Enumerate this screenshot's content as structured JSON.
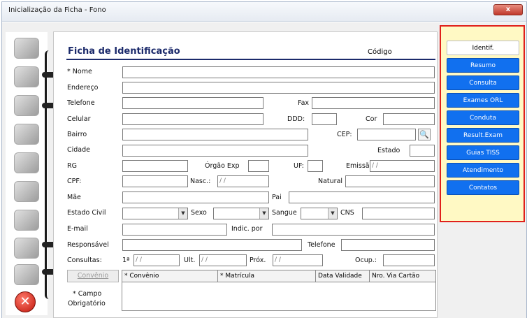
{
  "window": {
    "title": "Inicialização da Ficha - Fono",
    "close_glyph": "x"
  },
  "form": {
    "heading": "Ficha de Identificação",
    "codigo_label": "Código",
    "labels": {
      "nome": "* Nome",
      "endereco": "Endereço",
      "telefone": "Telefone",
      "fax": "Fax",
      "celular": "Celular",
      "ddd": "DDD:",
      "cor": "Cor",
      "bairro": "Bairro",
      "cep": "CEP:",
      "cidade": "Cidade",
      "estado": "Estado",
      "rg": "RG",
      "orgao": "Órgão Exp",
      "uf": "UF:",
      "emissao": "Emissão",
      "cpf": "CPF:",
      "nasc": "Nasc.:",
      "natural": "Natural",
      "mae": "Mãe",
      "pai": "Pai",
      "estado_civil": "Estado Civil",
      "sexo": "Sexo",
      "sangue": "Sangue",
      "cns": "CNS",
      "email": "E-mail",
      "indic_por": "Indic. por",
      "responsavel": "Responsável",
      "telefone2": "Telefone",
      "consultas": "Consultas:",
      "primeira": "1ª",
      "ult": "Ult.",
      "prox": "Próx.",
      "ocup": "Ocup.:"
    },
    "placeholders": {
      "date": " / /"
    },
    "convenio_button": "Convênio",
    "grid_headers": [
      "* Convênio",
      "* Matrícula",
      "Data Validade",
      "Nro. Via Cartão"
    ],
    "required_note_line1": "* Campo",
    "required_note_line2": "Obrigatório"
  },
  "side_tabs": [
    {
      "label": "Identif.",
      "active": true
    },
    {
      "label": "Resumo",
      "active": false
    },
    {
      "label": "Consulta",
      "active": false
    },
    {
      "label": "Exames ORL",
      "active": false
    },
    {
      "label": "Conduta",
      "active": false
    },
    {
      "label": "Result.Exam",
      "active": false
    },
    {
      "label": "Guias TISS",
      "active": false
    },
    {
      "label": "Atendimento",
      "active": false
    },
    {
      "label": "Contatos",
      "active": false
    }
  ],
  "icons": [
    "stethoscope-icon",
    "book-icon",
    "building-icon",
    "mouse-icon",
    "cabinet-icon",
    "papers-icon",
    "ruler-icon",
    "globe-icon",
    "tools-icon"
  ],
  "colors": {
    "accent": "#1170ef",
    "highlight_border": "#e0201b",
    "panel_bg": "#fff9c4",
    "heading": "#1b2a6b"
  }
}
